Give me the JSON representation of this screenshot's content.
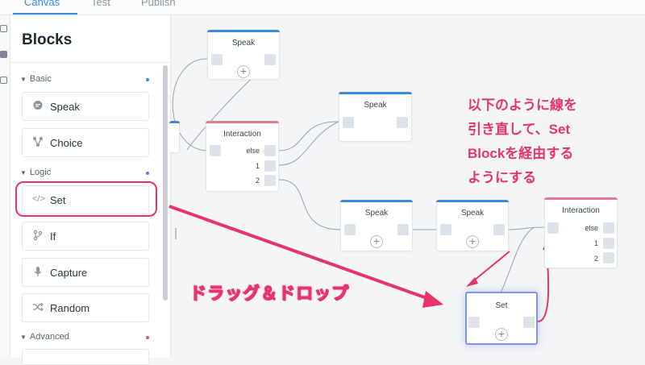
{
  "tabs": [
    {
      "label": "Canvas",
      "active": true
    },
    {
      "label": "Test",
      "active": false
    },
    {
      "label": "Publish",
      "active": false
    }
  ],
  "panel": {
    "title": "Blocks",
    "sections": [
      {
        "label": "Basic",
        "dot_color": "#3a8be0",
        "items": [
          {
            "label": "Speak",
            "icon": "speech-bubble-icon"
          },
          {
            "label": "Choice",
            "icon": "branch-nodes-icon"
          }
        ]
      },
      {
        "label": "Logic",
        "dot_color": "#5b7be8",
        "items": [
          {
            "label": "Set",
            "icon": "code-brackets-icon"
          },
          {
            "label": "If",
            "icon": "git-branch-icon"
          },
          {
            "label": "Capture",
            "icon": "microphone-icon"
          },
          {
            "label": "Random",
            "icon": "shuffle-icon"
          }
        ]
      },
      {
        "label": "Advanced",
        "dot_color": "#e8506b",
        "items": []
      }
    ]
  },
  "canvas": {
    "speak_label": "Speak",
    "interaction_label": "Interaction",
    "set_label": "Set",
    "outputs": [
      "else",
      "1",
      "2"
    ],
    "plus": "+"
  },
  "annotations": {
    "note_lines": [
      "以下のように線を",
      "引き直して、Set",
      "Blockを経由する",
      "ようにする"
    ],
    "drag_label": "ドラッグ＆ドロップ"
  },
  "colors": {
    "accent": "#3a8be0",
    "speak_cap": "#3a8be0",
    "interaction_cap": "#e8798f",
    "annotation": "#e8336b"
  }
}
